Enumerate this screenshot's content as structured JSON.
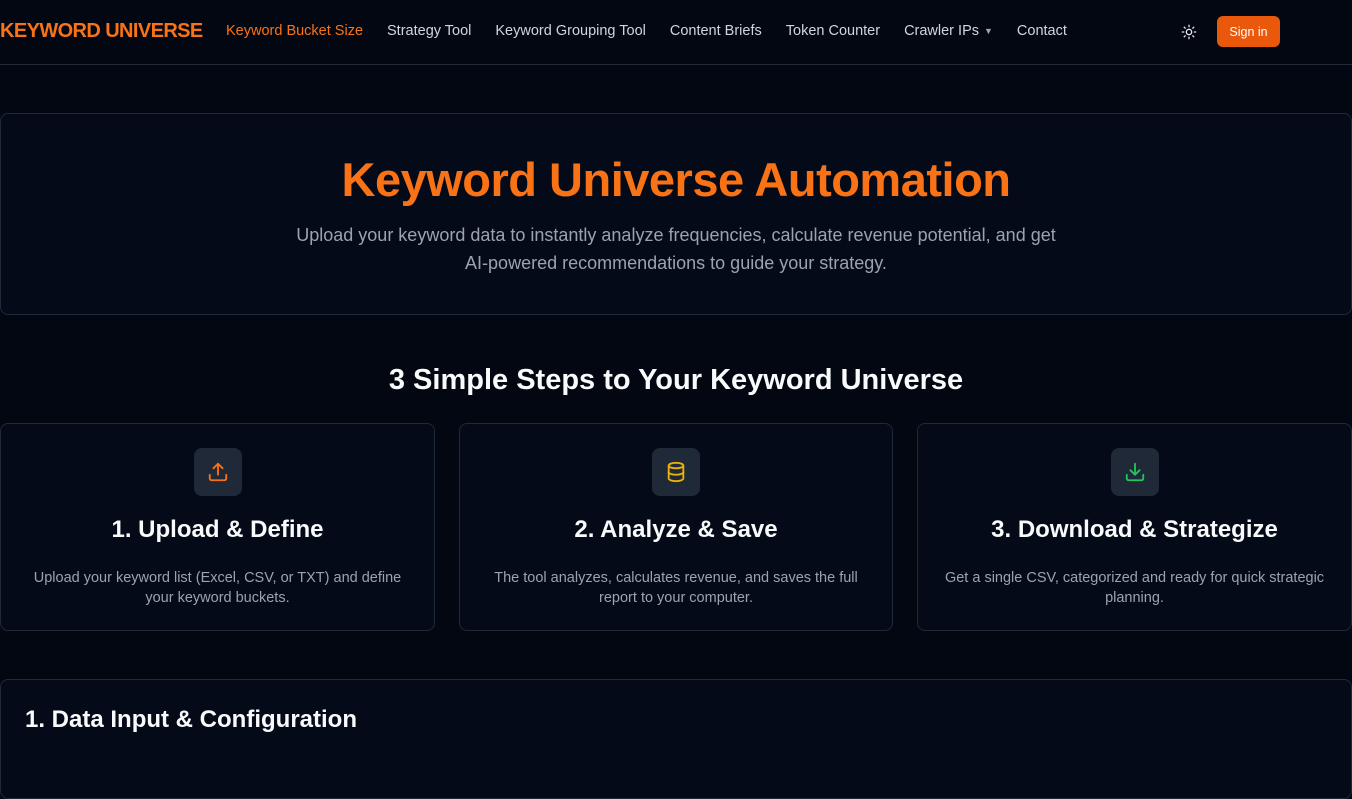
{
  "nav": {
    "logo": "KEYWORD UNIVERSE",
    "links": [
      {
        "label": "Keyword Bucket Size"
      },
      {
        "label": "Strategy Tool"
      },
      {
        "label": "Keyword Grouping Tool"
      },
      {
        "label": "Content Briefs"
      },
      {
        "label": "Token Counter"
      },
      {
        "label": "Crawler IPs"
      },
      {
        "label": "Contact"
      }
    ],
    "theme_icon": "sun-icon",
    "signin": "Sign in"
  },
  "hero": {
    "title": "Keyword Universe Automation",
    "subtitle": "Upload your keyword data to instantly analyze frequencies, calculate revenue potential, and get AI-powered recommendations to guide your strategy."
  },
  "steps": {
    "title": "3 Simple Steps to Your Keyword Universe",
    "items": [
      {
        "icon": "upload-icon",
        "title": "1. Upload & Define",
        "desc": "Upload your keyword list (Excel, CSV, or TXT) and define your keyword buckets."
      },
      {
        "icon": "database-icon",
        "title": "2. Analyze & Save",
        "desc": "The tool analyzes, calculates revenue, and saves the full report to your computer."
      },
      {
        "icon": "download-icon",
        "title": "3. Download & Strategize",
        "desc": "Get a single CSV, categorized and ready for quick strategic planning."
      }
    ]
  },
  "section1": {
    "title": "1. Data Input & Configuration"
  },
  "colors": {
    "accent": "#f97316",
    "background": "#030712",
    "upload": "#f97316",
    "database": "#eab308",
    "download": "#22c55e"
  }
}
